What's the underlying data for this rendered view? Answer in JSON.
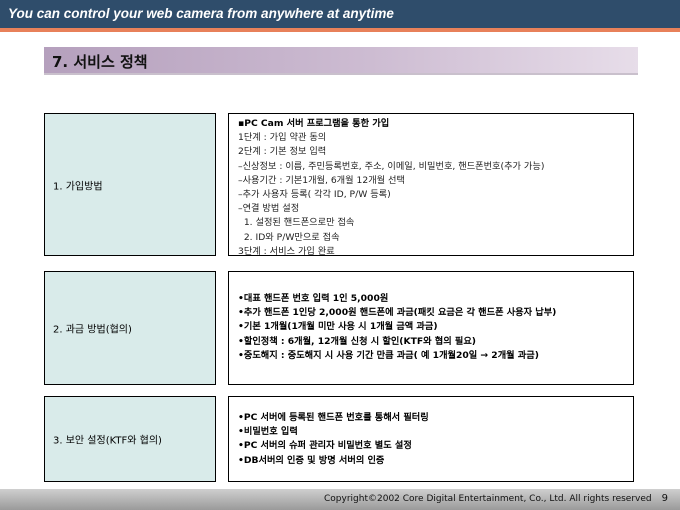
{
  "header": {
    "tagline": "You can control your web camera  from anywhere at anytime"
  },
  "section": {
    "title": "7. 서비스 정책"
  },
  "rows": [
    {
      "label": "1. 가입방법",
      "lines": [
        "▪PC Cam 서버 프로그램을 통한 가입",
        "1단계 : 가입 약관 동의",
        "2단계 : 기본 정보 입력",
        "–신상정보 : 이름, 주민등록번호, 주소, 이메일, 비밀번호, 핸드폰번호(추가 가능)",
        "–사용기간 : 기본1개월, 6개월 12개월 선택",
        "–추가 사용자 등록( 각각 ID, P/W 등록)",
        "–연결 방법 설정",
        "  1. 설정된 핸드폰으로만 접속",
        "  2. ID와 P/W만으로 접속",
        "3단계 : 서비스 가입 완료"
      ]
    },
    {
      "label": "2. 과금 방법(협의)",
      "lines": [
        "•대표 핸드폰 번호 입력 1인 5,000원",
        "•추가 핸드폰 1인당 2,000원 핸드폰에 과금(패킷 요금은 각 핸드폰 사용자 납부)",
        "•기본 1개월(1개월 미만 사용 시 1개월 금액 과금)",
        "•할인정책 : 6개월, 12개월 신청 시 할인(KTF와 협의 필요)",
        "•중도해지 : 중도해지 시 사용 기간 만큼 과금( 예 1개월20일 → 2개월 과금)"
      ]
    },
    {
      "label": "3. 보안 설정(KTF와 협의)",
      "lines": [
        "•PC 서버에 등록된 핸드폰 번호를 통해서 필터링",
        "•비밀번호 입력",
        "•PC 서버의 슈퍼 관리자 비밀번호 별도 설정",
        "•DB서버의 인증 및 방명 서버의 인증"
      ]
    }
  ],
  "footer": {
    "copyright": "Copyright©2002 Core Digital Entertainment, Co., Ltd. All rights reserved",
    "page_number": "9"
  },
  "colors": {
    "banner": "#2f4d6b",
    "banner_stripe": "#e8815a",
    "section_bar": "#b5a0bd",
    "label_fill": "#d9ebea"
  }
}
